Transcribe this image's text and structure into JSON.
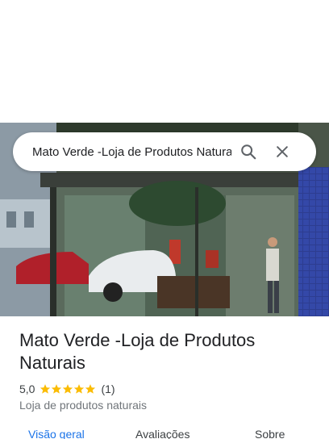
{
  "search": {
    "query": "Mato Verde -Loja de Produtos Naturais",
    "search_icon": "search-icon",
    "close_icon": "close-icon"
  },
  "photo": {
    "description_icon": "place-photo"
  },
  "place": {
    "name_line1": "Mato Verde -Loja de Produtos",
    "name_line2": "Naturais",
    "rating": "5,0",
    "stars": 5,
    "review_count": "(1)",
    "category": "Loja de produtos naturais"
  },
  "tabs": [
    {
      "label": "Visão geral",
      "active": true
    },
    {
      "label": "Avaliações",
      "active": false
    },
    {
      "label": "Sobre",
      "active": false
    }
  ],
  "colors": {
    "accent": "#1a73e8",
    "star": "#fbbc04"
  }
}
